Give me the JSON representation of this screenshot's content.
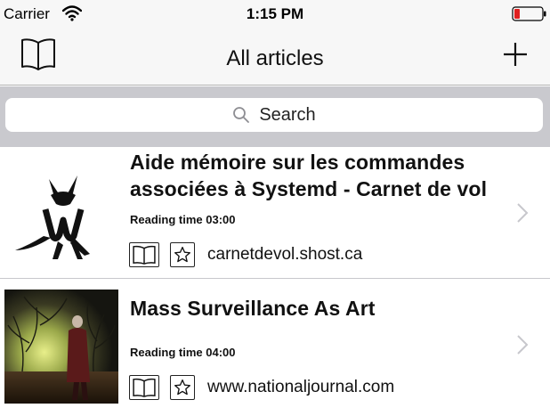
{
  "status": {
    "carrier": "Carrier",
    "time": "1:15 PM"
  },
  "nav": {
    "title": "All articles",
    "left_icon": "book-icon",
    "right_icon": "plus-icon"
  },
  "search": {
    "placeholder": "Search"
  },
  "articles": [
    {
      "title": "Aide mémoire sur les commandes associées à Systemd - Carnet de vol",
      "reading_time": "Reading time 03:00",
      "domain": "carnetdevol.shost.ca",
      "thumbnail": "wallabag-logo"
    },
    {
      "title": "Mass Surveillance As Art",
      "reading_time": "Reading time 04:00",
      "domain": "www.nationaljournal.com",
      "thumbnail": "forest-portrait-photo"
    }
  ],
  "colors": {
    "bar_background": "#f7f7f7",
    "search_background": "#c9c9ce",
    "battery_red": "#e02020",
    "chevron": "#c7c7cc"
  }
}
